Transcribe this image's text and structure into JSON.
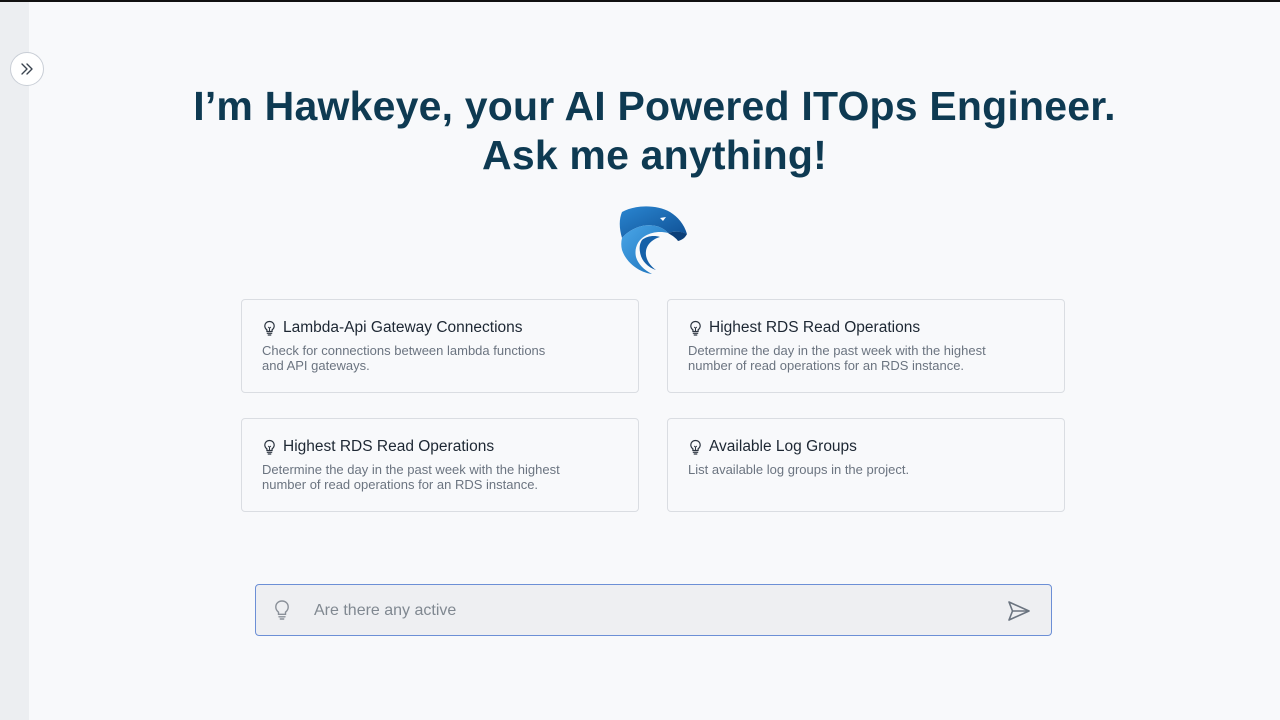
{
  "header": {
    "line1": "I’m Hawkeye, your AI Powered ITOps Engineer.",
    "line2": "Ask me anything!"
  },
  "icons": {
    "sidebar_toggle": "double-chevron-right-icon",
    "logo": "hawk-logo-icon",
    "suggestion": "lightbulb-icon",
    "send": "send-icon"
  },
  "colors": {
    "heading": "#0e3a52",
    "logo_blue": "#1a6fb8",
    "input_border": "#6c8fd6"
  },
  "suggestions": [
    {
      "title": "Lambda-Api Gateway Connections",
      "line1": "Check for connections between lambda functions",
      "line2": "and API gateways."
    },
    {
      "title": "Highest RDS Read Operations",
      "line1": "Determine the day in the past week with the highest",
      "line2": "number of read operations for an RDS instance."
    },
    {
      "title": "Highest RDS Read Operations",
      "line1": "Determine the day in the past week with the highest",
      "line2": "number of read operations for an RDS instance."
    },
    {
      "title": "Available Log Groups",
      "line1": "List available log groups in the project.",
      "line2": ""
    }
  ],
  "prompt": {
    "value": "Are there any active",
    "placeholder": ""
  }
}
